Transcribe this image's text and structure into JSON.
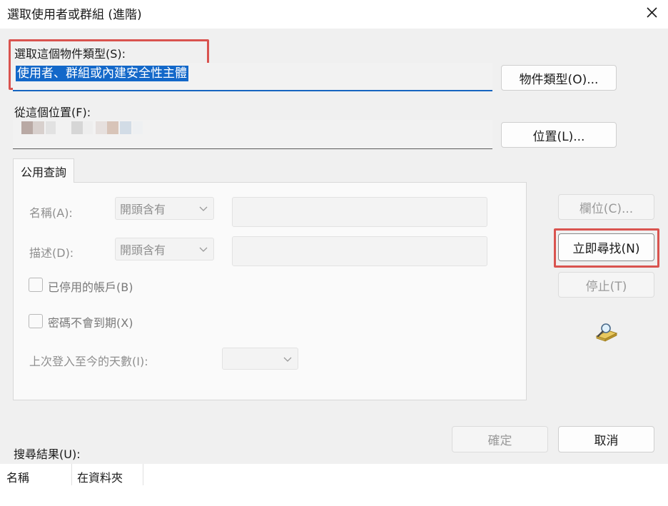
{
  "window": {
    "title": "選取使用者或群組 (進階)",
    "close_icon": "close-icon"
  },
  "object_type": {
    "label": "選取這個物件類型(S):",
    "value": "使用者、群組或內建安全性主體",
    "button": "物件類型(O)..."
  },
  "location": {
    "label": "從這個位置(F):",
    "value": "",
    "button": "位置(L)..."
  },
  "tab": {
    "label": "公用查詢"
  },
  "query": {
    "name_label": "名稱(A):",
    "name_mode": "開頭含有",
    "description_label": "描述(D):",
    "description_mode": "開頭含有",
    "disabled_accounts": "已停用的帳戶(B)",
    "non_expiring_password": "密碼不會到期(X)",
    "days_since_logon_label": "上次登入至今的天數(I):"
  },
  "buttons": {
    "columns": "欄位(C)...",
    "find_now": "立即尋找(N)",
    "stop": "停止(T)",
    "ok": "確定",
    "cancel": "取消"
  },
  "results": {
    "label": "搜尋結果(U):",
    "columns": [
      "名稱",
      "在資料夾"
    ]
  },
  "colors": {
    "accent": "#1368c9",
    "highlight_box": "#d9534f"
  },
  "icons": {
    "search_icon": "magnifier-over-directory"
  }
}
